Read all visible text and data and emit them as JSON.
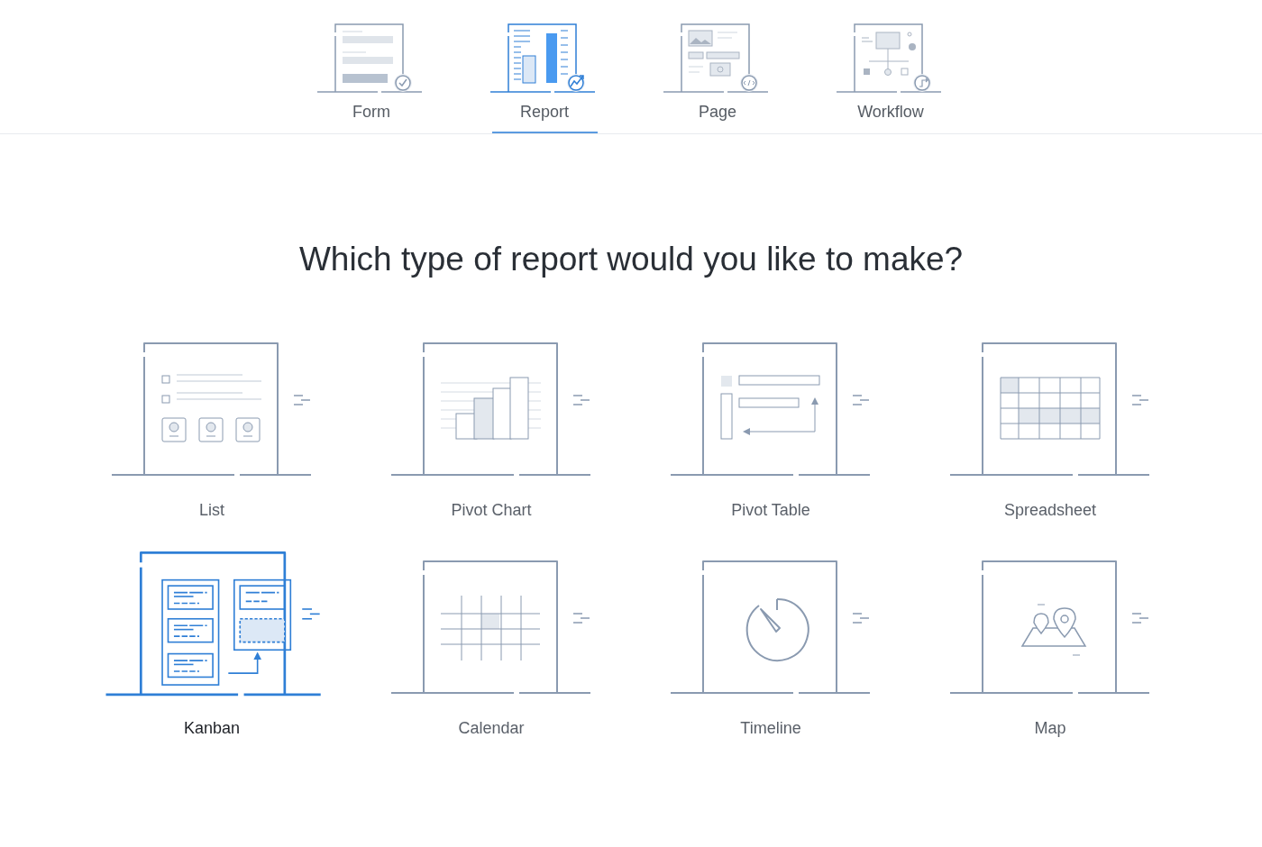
{
  "tabs": [
    {
      "label": "Form",
      "kind": "form",
      "selected": false
    },
    {
      "label": "Report",
      "kind": "report",
      "selected": true
    },
    {
      "label": "Page",
      "kind": "page",
      "selected": false
    },
    {
      "label": "Workflow",
      "kind": "workflow",
      "selected": false
    }
  ],
  "heading": "Which type of report would you like to make?",
  "report_types": [
    {
      "label": "List",
      "kind": "list",
      "selected": false
    },
    {
      "label": "Pivot Chart",
      "kind": "pivot-chart",
      "selected": false
    },
    {
      "label": "Pivot Table",
      "kind": "pivot-table",
      "selected": false
    },
    {
      "label": "Spreadsheet",
      "kind": "spreadsheet",
      "selected": false
    },
    {
      "label": "Kanban",
      "kind": "kanban",
      "selected": true
    },
    {
      "label": "Calendar",
      "kind": "calendar",
      "selected": false
    },
    {
      "label": "Timeline",
      "kind": "timeline",
      "selected": false
    },
    {
      "label": "Map",
      "kind": "map",
      "selected": false
    }
  ]
}
